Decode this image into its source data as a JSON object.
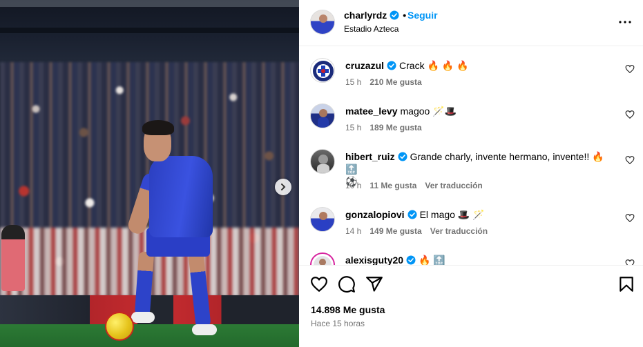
{
  "post": {
    "author": "charlyrdz",
    "follow_label": "Seguir",
    "separator": "•",
    "location": "Estadio Azteca",
    "likes_total": "14.898 Me gusta",
    "time_ago": "Hace 15 horas"
  },
  "comments": [
    {
      "user": "cruzazul",
      "verified": true,
      "text": "Crack 🔥 🔥 🔥",
      "time": "15 h",
      "likes": "210 Me gusta",
      "translate": ""
    },
    {
      "user": "matee_levy",
      "verified": false,
      "text": "magoo 🪄🎩",
      "time": "15 h",
      "likes": "189 Me gusta",
      "translate": ""
    },
    {
      "user": "hibert_ruiz",
      "verified": true,
      "text": "Grande charly, invente hermano, invente!! 🔥 🔝",
      "text2": "⚽",
      "time": "10 h",
      "likes": "11 Me gusta",
      "translate": "Ver traducción"
    },
    {
      "user": "gonzalopiovi",
      "verified": true,
      "text": "El mago 🎩 🪄",
      "time": "14 h",
      "likes": "149 Me gusta",
      "translate": "Ver traducción"
    },
    {
      "user": "alexisguty20",
      "verified": true,
      "text": "🔥 🔝",
      "time": "",
      "likes": "",
      "translate": ""
    }
  ],
  "icons": {
    "verified": "verified-badge-icon",
    "more": "more-options-icon",
    "next": "chevron-right-icon",
    "like": "heart-icon",
    "comment": "comment-bubble-icon",
    "share": "paper-plane-icon",
    "save": "bookmark-icon"
  },
  "colors": {
    "accent": "#0095f6",
    "verified": "#0095f6",
    "muted": "#737373",
    "divider": "#efefef"
  }
}
